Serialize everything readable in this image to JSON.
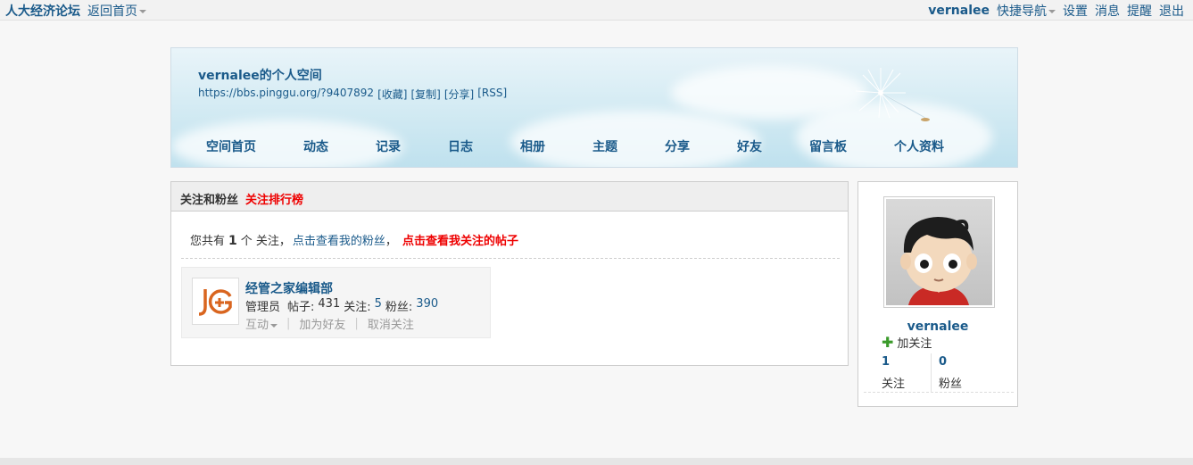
{
  "topbar": {
    "site_name": "人大经济论坛",
    "back_home": "返回首页",
    "username": "vernalee",
    "quick_nav": "快捷导航",
    "settings": "设置",
    "messages": "消息",
    "reminders": "提醒",
    "logout": "退出"
  },
  "banner": {
    "title": "vernalee的个人空间",
    "url": "https://bbs.pinggu.org/?9407892",
    "actions": [
      "[收藏]",
      "[复制]",
      "[分享]",
      "[RSS]"
    ],
    "nav": [
      "空间首页",
      "动态",
      "记录",
      "日志",
      "相册",
      "主题",
      "分享",
      "好友",
      "留言板",
      "个人资料"
    ]
  },
  "panel": {
    "tab_active": "关注和粉丝",
    "tab_ranking": "关注排行榜",
    "summary_prefix": "您共有",
    "summary_count": "1",
    "summary_suffix": "个 关注，",
    "link_fans": "点击查看我的粉丝",
    "comma": "，",
    "link_posts": "点击查看我关注的帖子"
  },
  "follow_card": {
    "name": "经管之家编辑部",
    "role": "管理员",
    "posts_label": "帖子:",
    "posts": "431",
    "following_label": "关注:",
    "following": "5",
    "fans_label": "粉丝:",
    "fans": "390",
    "action_interact": "互动",
    "action_add_friend": "加为好友",
    "action_unfollow": "取消关注",
    "logo_text": "JG"
  },
  "profile": {
    "username": "vernalee",
    "follow_label": "加关注",
    "following_count": "1",
    "following_label": "关注",
    "fans_count": "0",
    "fans_label": "粉丝"
  },
  "colors": {
    "link": "#1a5a8a",
    "highlight_red": "#e00000",
    "plus_green": "#3a9a2a",
    "logo_orange": "#d9651f"
  }
}
